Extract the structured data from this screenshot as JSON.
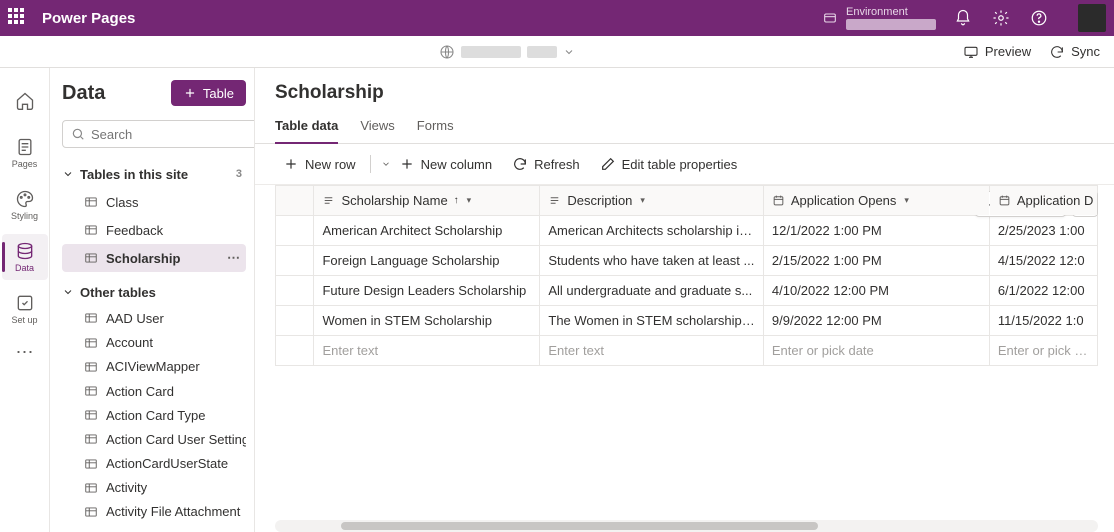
{
  "colors": {
    "accent": "#742774"
  },
  "header": {
    "brand": "Power Pages",
    "env_label": "Environment",
    "icons": {
      "waffle": "app-launcher-icon",
      "bell": "notification-icon",
      "gear": "settings-icon",
      "help": "help-icon"
    }
  },
  "subbar": {
    "globe_redacted_segments": 2,
    "preview": "Preview",
    "sync": "Sync"
  },
  "rail": {
    "items": [
      {
        "id": "home",
        "label": "",
        "icon": "home-icon"
      },
      {
        "id": "pages",
        "label": "Pages",
        "icon": "pages-icon"
      },
      {
        "id": "styling",
        "label": "Styling",
        "icon": "styling-icon"
      },
      {
        "id": "data",
        "label": "Data",
        "icon": "data-icon",
        "active": true
      },
      {
        "id": "setup",
        "label": "Set up",
        "icon": "setup-icon"
      }
    ]
  },
  "datapanel": {
    "title": "Data",
    "table_button": "Table",
    "search_placeholder": "Search",
    "groups": {
      "this_site": {
        "label": "Tables in this site",
        "count": "3",
        "items": [
          {
            "label": "Class"
          },
          {
            "label": "Feedback"
          },
          {
            "label": "Scholarship",
            "active": true
          }
        ]
      },
      "other": {
        "label": "Other tables",
        "items": [
          {
            "label": "AAD User"
          },
          {
            "label": "Account"
          },
          {
            "label": "ACIViewMapper"
          },
          {
            "label": "Action Card"
          },
          {
            "label": "Action Card Type"
          },
          {
            "label": "Action Card User Settings"
          },
          {
            "label": "ActionCardUserState"
          },
          {
            "label": "Activity"
          },
          {
            "label": "Activity File Attachment"
          }
        ]
      }
    }
  },
  "main": {
    "title": "Scholarship",
    "tabs": [
      {
        "label": "Table data",
        "active": true
      },
      {
        "label": "Views"
      },
      {
        "label": "Forms"
      }
    ],
    "commands": {
      "new_row": "New row",
      "new_column": "New column",
      "refresh": "Refresh",
      "edit_props": "Edit table properties"
    },
    "more_columns": "+31 more",
    "columns": [
      {
        "key": "name",
        "label": "Scholarship Name",
        "type": "text",
        "sorted_asc": true
      },
      {
        "key": "desc",
        "label": "Description",
        "type": "text"
      },
      {
        "key": "open",
        "label": "Application Opens",
        "type": "date"
      },
      {
        "key": "dead",
        "label": "Application D",
        "type": "date"
      }
    ],
    "rows": [
      {
        "name": "American Architect Scholarship",
        "desc": "American Architects scholarship is...",
        "open": "12/1/2022 1:00 PM",
        "dead": "2/25/2023 1:00"
      },
      {
        "name": "Foreign Language Scholarship",
        "desc": "Students who have taken at least ...",
        "open": "2/15/2022 1:00 PM",
        "dead": "4/15/2022 12:0"
      },
      {
        "name": "Future Design Leaders Scholarship",
        "desc": "All undergraduate and graduate s...",
        "open": "4/10/2022 12:00 PM",
        "dead": "6/1/2022 12:00"
      },
      {
        "name": "Women in STEM Scholarship",
        "desc": "The Women in STEM scholarship i...",
        "open": "9/9/2022 12:00 PM",
        "dead": "11/15/2022 1:0"
      }
    ],
    "new_row_placeholders": {
      "name": "Enter text",
      "desc": "Enter text",
      "open": "Enter or pick date",
      "dead": "Enter or pick dat"
    }
  }
}
